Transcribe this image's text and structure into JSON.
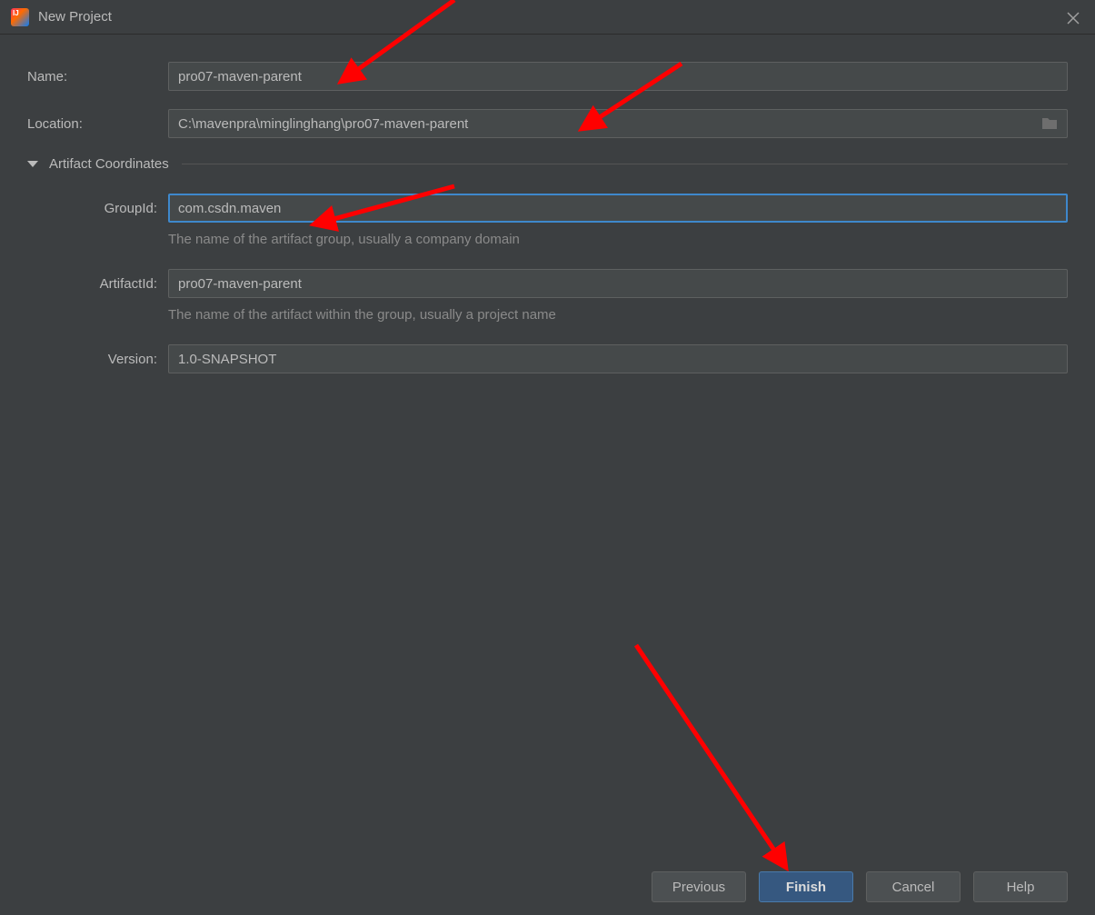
{
  "window": {
    "title": "New Project"
  },
  "fields": {
    "name_label": "Name:",
    "name_value": "pro07-maven-parent",
    "location_label": "Location:",
    "location_value": "C:\\mavenpra\\minglinghang\\pro07-maven-parent"
  },
  "section": {
    "title": "Artifact Coordinates",
    "expanded": true
  },
  "artifact": {
    "groupid_label": "GroupId:",
    "groupid_value": "com.csdn.maven",
    "groupid_hint": "The name of the artifact group, usually a company domain",
    "artifactid_label": "ArtifactId:",
    "artifactid_value": "pro07-maven-parent",
    "artifactid_hint": "The name of the artifact within the group, usually a project name",
    "version_label": "Version:",
    "version_value": "1.0-SNAPSHOT"
  },
  "buttons": {
    "previous": "Previous",
    "finish": "Finish",
    "cancel": "Cancel",
    "help": "Help"
  }
}
